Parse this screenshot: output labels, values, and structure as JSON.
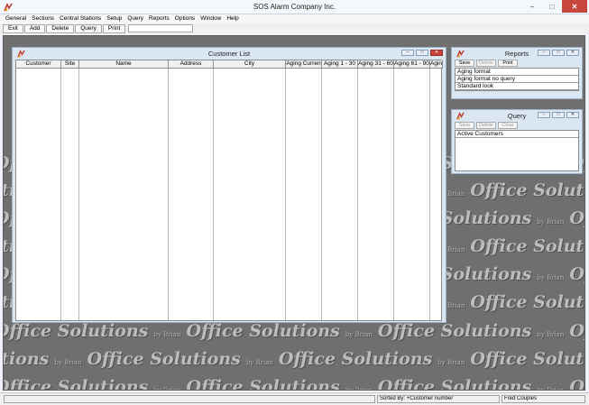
{
  "app": {
    "title": "SOS Alarm Company Inc."
  },
  "menu": [
    "General",
    "Sections",
    "Central Stations",
    "Setup",
    "Query",
    "Reports",
    "Options",
    "Window",
    "Help"
  ],
  "toolbar": {
    "exit": "Exit",
    "add": "Add",
    "delete": "Delete",
    "query": "Query",
    "print": "Print"
  },
  "watermark": {
    "text": "Office Solutions",
    "byline": "by Brian"
  },
  "customer_list": {
    "title": "Customer List",
    "columns": [
      "Customer",
      "Site",
      "Name",
      "Address",
      "City",
      "Aging Curren",
      "Aging 1 - 30",
      "Aging 31 - 60",
      "Aging 61 - 90",
      "Aginc"
    ]
  },
  "reports_panel": {
    "title": "Reports",
    "buttons": {
      "save": "Save",
      "delete": "Delete",
      "print": "Print"
    },
    "items": [
      "Aging format",
      "Aging format no query",
      "Standard look"
    ]
  },
  "query_panel": {
    "title": "Query",
    "buttons": {
      "save": "Save",
      "delete": "Delete",
      "clear": "Clear"
    },
    "items": [
      "Active Customers"
    ]
  },
  "status": {
    "sorted_by_label": "Sorted By:",
    "sorted_by_value": "+Customer number",
    "user": "Fred Couples"
  },
  "colors": {
    "close_button": "#c7463c",
    "desktop": "#6f6f6f",
    "window_frame": "#dbe6f3"
  }
}
